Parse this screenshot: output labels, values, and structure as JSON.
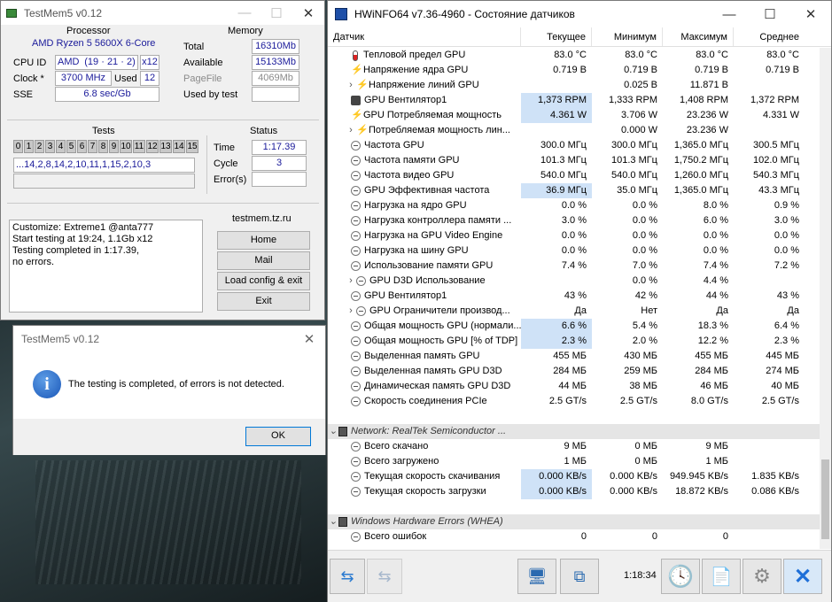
{
  "testmem": {
    "title": "TestMem5 v0.12",
    "processor": {
      "label": "Processor",
      "name": "AMD Ryzen 5 5600X 6-Core",
      "cpu_id_label": "CPU ID",
      "cpu_id_vendor": "AMD",
      "cpu_id_family": "(19 · 21 · 2)",
      "cpu_id_threads": "x12",
      "clock_label": "Clock *",
      "clock_value": "3700 MHz",
      "used_label": "Used",
      "used_value": "12",
      "sse_label": "SSE",
      "sse_value": "6.8 sec/Gb"
    },
    "memory": {
      "label": "Memory",
      "total_label": "Total",
      "total_value": "16310Mb",
      "available_label": "Available",
      "available_value": "15133Mb",
      "pagefile_label": "PageFile",
      "pagefile_value": "4069Mb",
      "used_by_test_label": "Used by test",
      "used_by_test_value": ""
    },
    "tests": {
      "label": "Tests",
      "numbers": [
        "0",
        "1",
        "2",
        "3",
        "4",
        "5",
        "6",
        "7",
        "8",
        "9",
        "10",
        "11",
        "12",
        "13",
        "14",
        "15"
      ],
      "sequence": "...14,2,8,14,2,10,11,1,15,2,10,3"
    },
    "status": {
      "label": "Status",
      "time_label": "Time",
      "time_value": "1:17.39",
      "cycle_label": "Cycle",
      "cycle_value": "3",
      "errors_label": "Error(s)",
      "errors_value": ""
    },
    "log": [
      "Customize: Extreme1 @anta777",
      "Start testing at 19:24, 1.1Gb x12",
      "Testing completed in 1:17.39,",
      "no errors."
    ],
    "site": {
      "label": "testmem.tz.ru",
      "home": "Home",
      "mail": "Mail",
      "load": "Load config & exit",
      "exit": "Exit"
    }
  },
  "dialog": {
    "title": "TestMem5 v0.12",
    "message": "The testing is completed, of errors is not detected.",
    "ok": "OK"
  },
  "hwinfo": {
    "title": "HWiNFO64 v7.36-4960 - Состояние датчиков",
    "columns": [
      "Датчик",
      "Текущее",
      "Минимум",
      "Максимум",
      "Среднее"
    ],
    "rows": [
      {
        "i": "therm",
        "n": "Тепловой предел GPU",
        "c": "83.0 °C",
        "mi": "83.0 °C",
        "ma": "83.0 °C",
        "av": "83.0 °C"
      },
      {
        "i": "bolt",
        "n": "Напряжение ядра GPU",
        "c": "0.719 В",
        "mi": "0.719 В",
        "ma": "0.719 В",
        "av": "0.719 В"
      },
      {
        "i": "bolt",
        "x": true,
        "n": "Напряжение линий GPU",
        "c": "",
        "mi": "0.025 В",
        "ma": "11.871 В",
        "av": ""
      },
      {
        "i": "fan",
        "n": "GPU Вентилятор1",
        "c": "1,373 RPM",
        "mi": "1,333 RPM",
        "ma": "1,408 RPM",
        "av": "1,372 RPM",
        "h": true
      },
      {
        "i": "bolt",
        "n": "GPU Потребляемая мощность",
        "c": "4.361 W",
        "mi": "3.706 W",
        "ma": "23.236 W",
        "av": "4.331 W",
        "h": true
      },
      {
        "i": "bolt",
        "x": true,
        "n": "Потребляемая мощность лин...",
        "c": "",
        "mi": "0.000 W",
        "ma": "23.236 W",
        "av": ""
      },
      {
        "i": "ic",
        "n": "Частота GPU",
        "c": "300.0 МГц",
        "mi": "300.0 МГц",
        "ma": "1,365.0 МГц",
        "av": "300.5 МГц"
      },
      {
        "i": "ic",
        "n": "Частота памяти GPU",
        "c": "101.3 МГц",
        "mi": "101.3 МГц",
        "ma": "1,750.2 МГц",
        "av": "102.0 МГц"
      },
      {
        "i": "ic",
        "n": "Частота видео GPU",
        "c": "540.0 МГц",
        "mi": "540.0 МГц",
        "ma": "1,260.0 МГц",
        "av": "540.3 МГц"
      },
      {
        "i": "ic",
        "n": "GPU Эффективная частота",
        "c": "36.9 МГц",
        "mi": "35.0 МГц",
        "ma": "1,365.0 МГц",
        "av": "43.3 МГц",
        "h": true
      },
      {
        "i": "ic",
        "n": "Нагрузка на ядро GPU",
        "c": "0.0 %",
        "mi": "0.0 %",
        "ma": "8.0 %",
        "av": "0.9 %"
      },
      {
        "i": "ic",
        "n": "Нагрузка контроллера памяти ...",
        "c": "3.0 %",
        "mi": "0.0 %",
        "ma": "6.0 %",
        "av": "3.0 %"
      },
      {
        "i": "ic",
        "n": "Нагрузка на GPU Video Engine",
        "c": "0.0 %",
        "mi": "0.0 %",
        "ma": "0.0 %",
        "av": "0.0 %"
      },
      {
        "i": "ic",
        "n": "Нагрузка на шину GPU",
        "c": "0.0 %",
        "mi": "0.0 %",
        "ma": "0.0 %",
        "av": "0.0 %"
      },
      {
        "i": "ic",
        "n": "Использование памяти GPU",
        "c": "7.4 %",
        "mi": "7.0 %",
        "ma": "7.4 %",
        "av": "7.2 %"
      },
      {
        "i": "ic",
        "x": true,
        "n": "GPU D3D Использование",
        "c": "",
        "mi": "0.0 %",
        "ma": "4.4 %",
        "av": ""
      },
      {
        "i": "ic",
        "n": "GPU Вентилятор1",
        "c": "43 %",
        "mi": "42 %",
        "ma": "44 %",
        "av": "43 %"
      },
      {
        "i": "ic",
        "x": true,
        "n": "GPU Ограничители производ...",
        "c": "Да",
        "mi": "Нет",
        "ma": "Да",
        "av": "Да"
      },
      {
        "i": "ic",
        "n": "Общая мощность GPU (нормали...",
        "c": "6.6 %",
        "mi": "5.4 %",
        "ma": "18.3 %",
        "av": "6.4 %",
        "h": true
      },
      {
        "i": "ic",
        "n": "Общая мощность GPU [% of TDP]",
        "c": "2.3 %",
        "mi": "2.0 %",
        "ma": "12.2 %",
        "av": "2.3 %",
        "h": true
      },
      {
        "i": "ic",
        "n": "Выделенная память GPU",
        "c": "455 МБ",
        "mi": "430 МБ",
        "ma": "455 МБ",
        "av": "445 МБ"
      },
      {
        "i": "ic",
        "n": "Выделенная память GPU D3D",
        "c": "284 МБ",
        "mi": "259 МБ",
        "ma": "284 МБ",
        "av": "274 МБ"
      },
      {
        "i": "ic",
        "n": "Динамическая память GPU D3D",
        "c": "44 МБ",
        "mi": "38 МБ",
        "ma": "46 МБ",
        "av": "40 МБ"
      },
      {
        "i": "ic",
        "n": "Скорость соединения PCIe",
        "c": "2.5 GT/s",
        "mi": "2.5 GT/s",
        "ma": "8.0 GT/s",
        "av": "2.5 GT/s"
      },
      {
        "blank": true
      },
      {
        "sec": true,
        "n": "Network: RealTek Semiconductor ..."
      },
      {
        "i": "ic",
        "n": "Всего скачано",
        "c": "9 МБ",
        "mi": "0 МБ",
        "ma": "9 МБ",
        "av": ""
      },
      {
        "i": "ic",
        "n": "Всего загружено",
        "c": "1 МБ",
        "mi": "0 МБ",
        "ma": "1 МБ",
        "av": ""
      },
      {
        "i": "ic",
        "n": "Текущая скорость скачивания",
        "c": "0.000 KB/s",
        "mi": "0.000 KB/s",
        "ma": "949.945 KB/s",
        "av": "1.835 KB/s",
        "h": true
      },
      {
        "i": "ic",
        "n": "Текущая скорость загрузки",
        "c": "0.000 KB/s",
        "mi": "0.000 KB/s",
        "ma": "18.872 KB/s",
        "av": "0.086 KB/s",
        "h": true
      },
      {
        "blank": true
      },
      {
        "sec": true,
        "n": "Windows Hardware Errors (WHEA)"
      },
      {
        "i": "ic",
        "n": "Всего ошибок",
        "c": "0",
        "mi": "0",
        "ma": "0",
        "av": ""
      }
    ],
    "time": "1:18:34"
  }
}
